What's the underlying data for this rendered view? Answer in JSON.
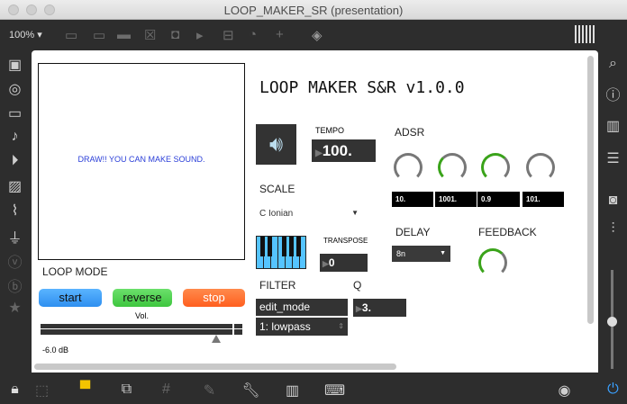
{
  "window": {
    "title": "LOOP_MAKER_SR (presentation)",
    "zoom": "100%"
  },
  "patch": {
    "title": "LOOP MAKER S&R v1.0.0",
    "draw_message": "DRAW!! YOU CAN MAKE SOUND.",
    "loop_mode_label": "LOOP MODE",
    "buttons": {
      "start": "start",
      "reverse": "reverse",
      "stop": "stop"
    },
    "vol_label": "Vol.",
    "vol_db": "-6.0 dB",
    "tempo_label": "TEMPO",
    "tempo_value": "100.",
    "adsr_label": "ADSR",
    "adsr_values": [
      "10.",
      "1001.",
      "0.9",
      "101."
    ],
    "scale_label": "SCALE",
    "scale_value": "C Ionian",
    "transpose_label": "TRANSPOSE",
    "transpose_value": "0",
    "delay_label": "DELAY",
    "delay_value": "8n",
    "feedback_label": "FEEDBACK",
    "filter_label": "FILTER",
    "filter_mode": "edit_mode",
    "filter_type": "1: lowpass",
    "q_label": "Q",
    "q_value": "3."
  },
  "colors": {
    "start": "#2e9bff",
    "reverse": "#47d44d",
    "stop": "#ff6a2a",
    "keyboard": "#55c4ff",
    "dial_active": "#3aa31a"
  }
}
